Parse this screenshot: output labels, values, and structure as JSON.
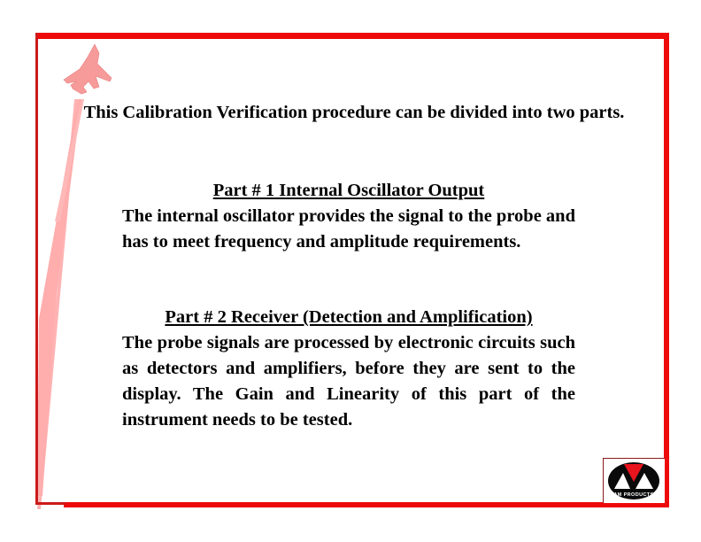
{
  "slide": {
    "intro": "This Calibration Verification procedure can be divided into two parts.",
    "parts": [
      {
        "heading": "Part # 1  Internal Oscillator Output",
        "body": "The internal oscillator provides the signal to the probe and has to meet frequency and amplitude requirements."
      },
      {
        "heading": "Part # 2 Receiver (Detection and Amplification)",
        "body": "The probe signals are processed by electronic circuits such as detectors and amplifiers, before they are sent to the display. The Gain and Linearity of this part of the instrument needs to be tested."
      }
    ],
    "logo": {
      "text": "AM PRODUCTS"
    },
    "colors": {
      "frame": "#ee0a0a",
      "jet": "#ff9a9a",
      "logo_triangle": "#e8141e"
    }
  }
}
